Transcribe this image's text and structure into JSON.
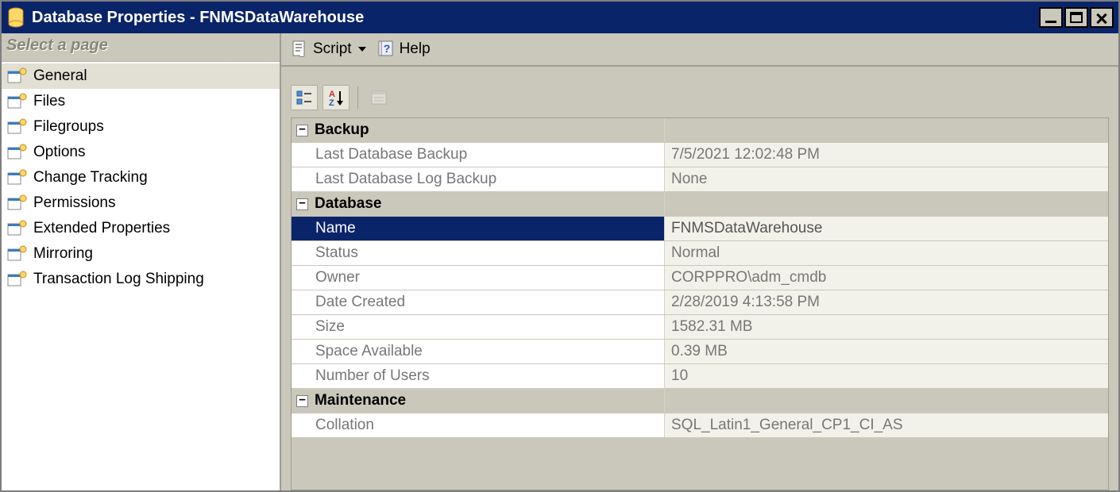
{
  "window": {
    "title": "Database Properties - FNMSDataWarehouse"
  },
  "sidebar": {
    "header": "Select a page",
    "items": [
      {
        "label": "General"
      },
      {
        "label": "Files"
      },
      {
        "label": "Filegroups"
      },
      {
        "label": "Options"
      },
      {
        "label": "Change Tracking"
      },
      {
        "label": "Permissions"
      },
      {
        "label": "Extended Properties"
      },
      {
        "label": "Mirroring"
      },
      {
        "label": "Transaction Log Shipping"
      }
    ]
  },
  "toolbar": {
    "script_label": "Script",
    "help_label": "Help"
  },
  "propgrid": {
    "groups": {
      "backup": {
        "title": "Backup",
        "rows": {
          "last_backup": {
            "label": "Last Database Backup",
            "value": "7/5/2021 12:02:48 PM"
          },
          "last_log_backup": {
            "label": "Last Database Log Backup",
            "value": "None"
          }
        }
      },
      "database": {
        "title": "Database",
        "rows": {
          "name": {
            "label": "Name",
            "value": "FNMSDataWarehouse"
          },
          "status": {
            "label": "Status",
            "value": "Normal"
          },
          "owner": {
            "label": "Owner",
            "value": "CORPPRO\\adm_cmdb"
          },
          "date_created": {
            "label": "Date Created",
            "value": "2/28/2019 4:13:58 PM"
          },
          "size": {
            "label": "Size",
            "value": "1582.31 MB"
          },
          "space_available": {
            "label": "Space Available",
            "value": "0.39 MB"
          },
          "num_users": {
            "label": "Number of Users",
            "value": "10"
          }
        }
      },
      "maintenance": {
        "title": "Maintenance",
        "rows": {
          "collation": {
            "label": "Collation",
            "value": "SQL_Latin1_General_CP1_CI_AS"
          }
        }
      }
    }
  }
}
